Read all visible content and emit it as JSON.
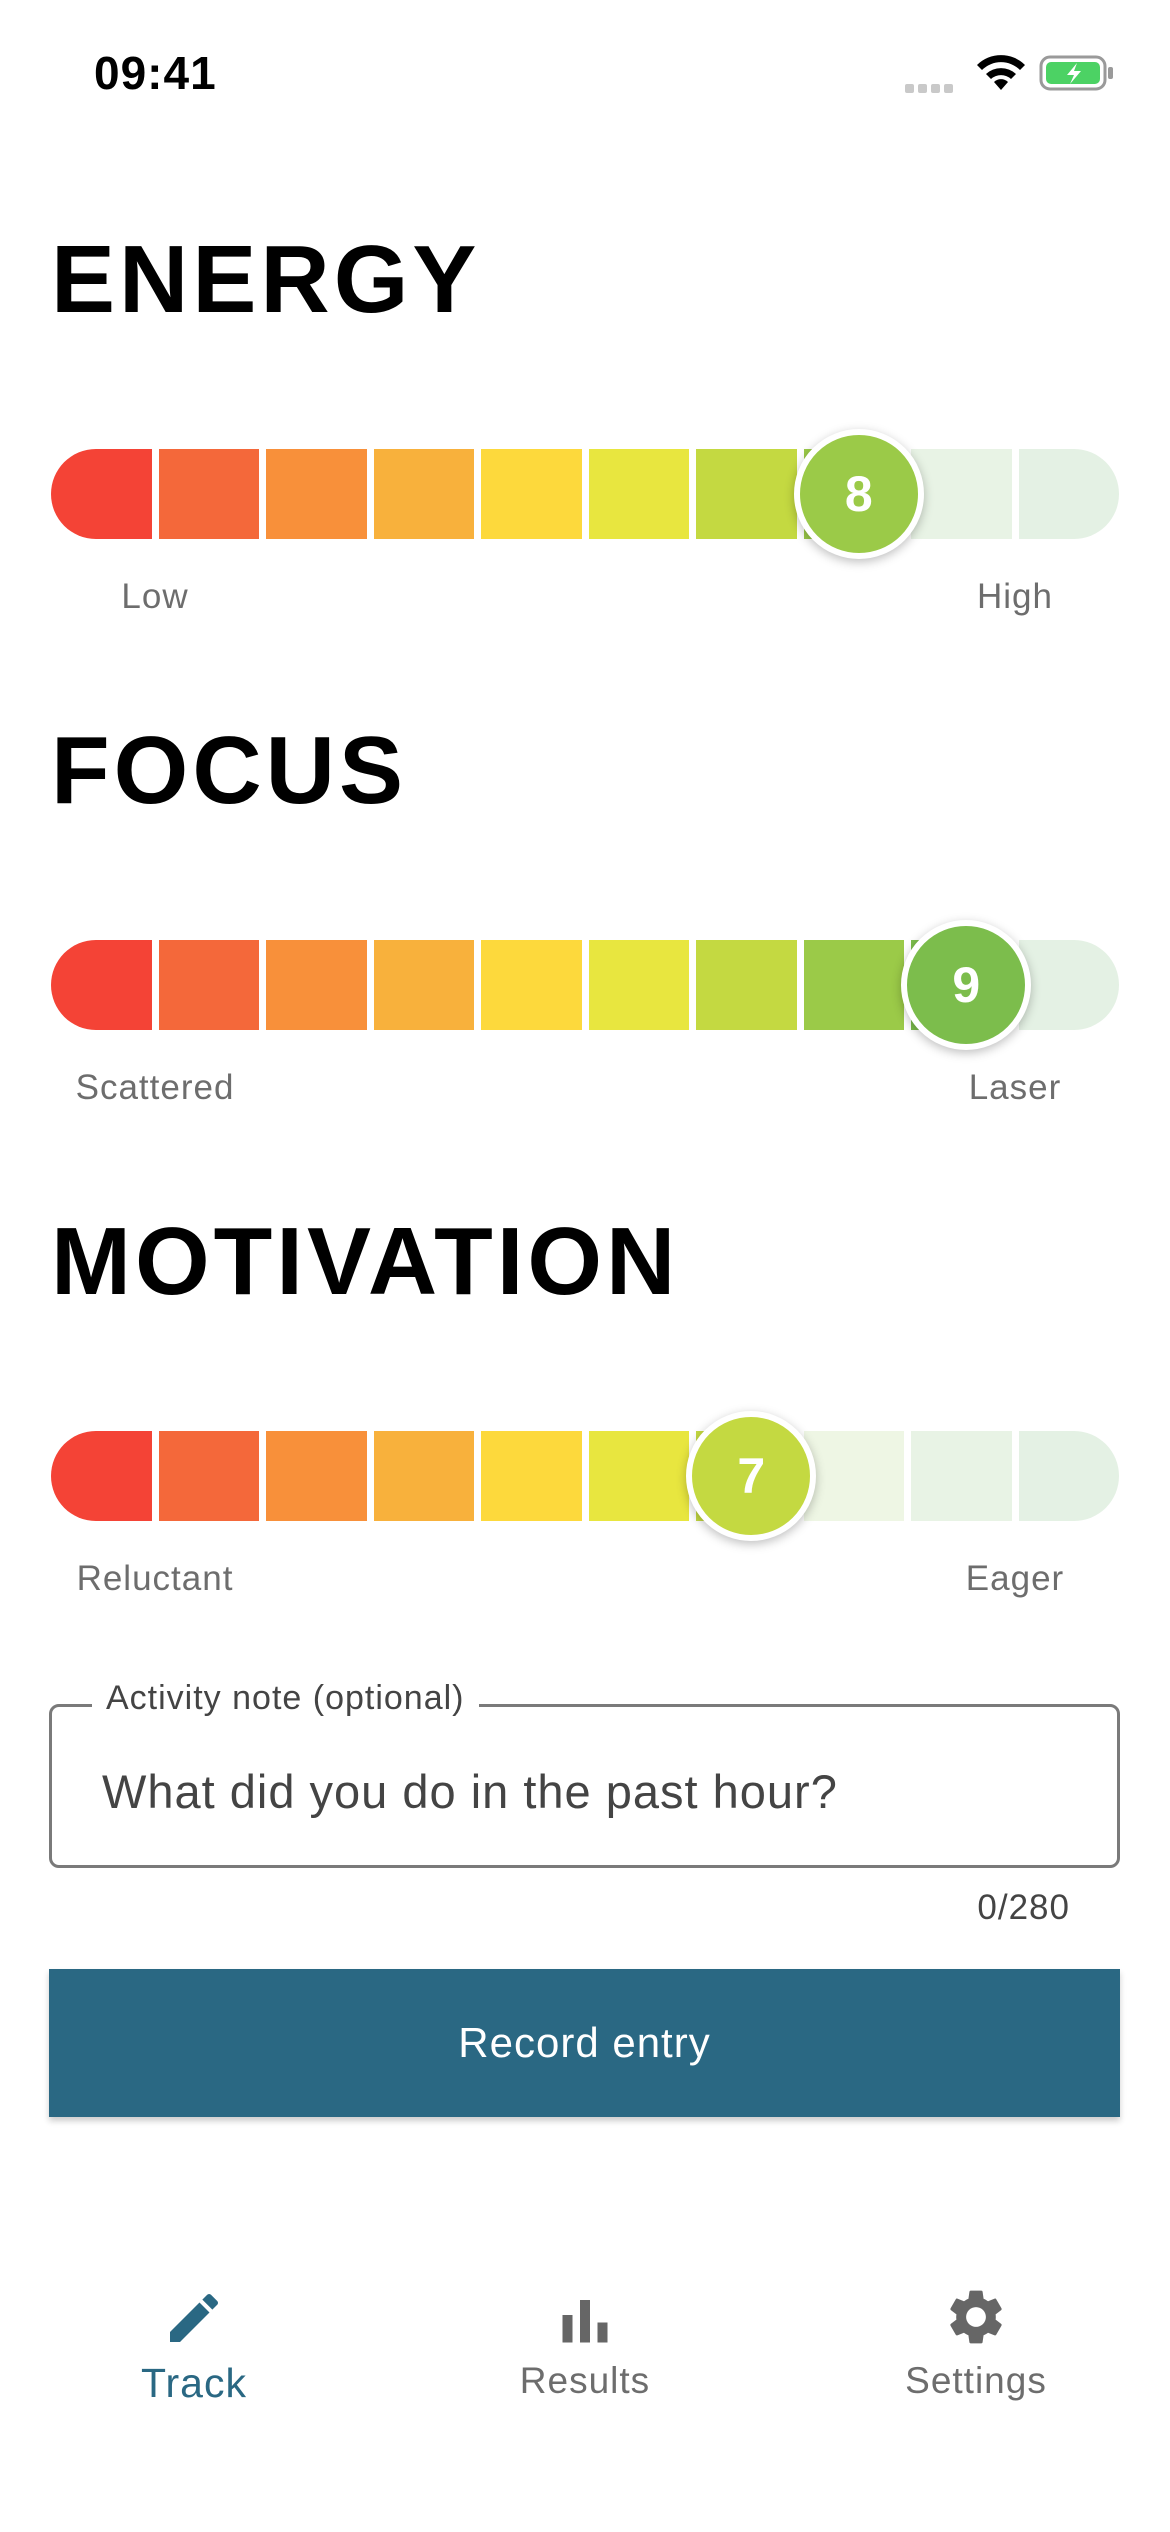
{
  "status_bar": {
    "time": "09:41"
  },
  "sliders": [
    {
      "title": "ENERGY",
      "value": 8,
      "min_label": "Low",
      "max_label": "High"
    },
    {
      "title": "FOCUS",
      "value": 9,
      "min_label": "Scattered",
      "max_label": "Laser"
    },
    {
      "title": "MOTIVATION",
      "value": 7,
      "min_label": "Reluctant",
      "max_label": "Eager"
    }
  ],
  "scale_colors": [
    "#f44336",
    "#f4683a",
    "#f8903a",
    "#f8b13c",
    "#fdd93c",
    "#e8e63f",
    "#c4d941",
    "#9bca48",
    "#7cbd4c",
    "#6ab04f"
  ],
  "inactive_colors": [
    "#eef6e4",
    "#e8f3e5",
    "#e4f1e4"
  ],
  "note": {
    "label": "Activity note (optional)",
    "placeholder": "What did you do in the past hour?",
    "counter": "0/280"
  },
  "record_button": "Record entry",
  "nav": [
    {
      "label": "Track",
      "icon": "pencil-icon",
      "active": true
    },
    {
      "label": "Results",
      "icon": "bar-chart-icon",
      "active": false
    },
    {
      "label": "Settings",
      "icon": "gear-icon",
      "active": false
    }
  ],
  "accent": "#2a6883"
}
